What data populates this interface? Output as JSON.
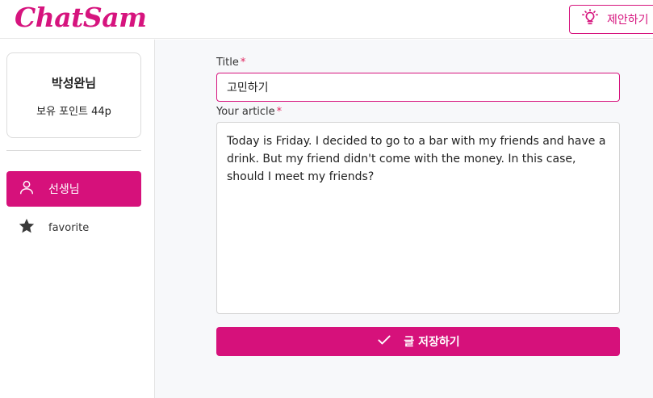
{
  "header": {
    "logo_text": "ChatSam",
    "suggest_label": "제안하기",
    "suggest_icon": "lightbulb-icon"
  },
  "sidebar": {
    "profile": {
      "name": "박성완님",
      "points": "보유 포인트 44p"
    },
    "items": [
      {
        "label": "선생님",
        "icon": "person-icon",
        "active": true
      },
      {
        "label": "favorite",
        "icon": "star-icon",
        "active": false
      }
    ]
  },
  "form": {
    "title_label": "Title",
    "title_value": "고민하기",
    "article_label": "Your article",
    "article_value": "Today is Friday. I decided to go to a bar with my friends and have a drink. But my friend didn't come with the money. In this case, should I meet my friends?",
    "required_mark": "*",
    "save_label": "글 저장하기",
    "save_icon": "check-icon"
  },
  "colors": {
    "accent": "#d6117b",
    "background": "#f7f8fa"
  }
}
